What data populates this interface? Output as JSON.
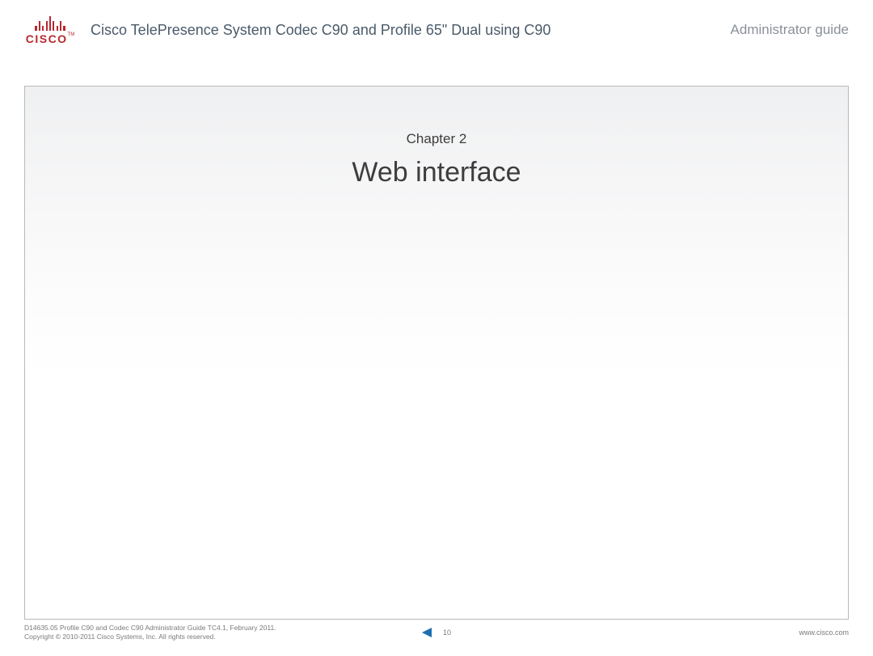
{
  "header": {
    "logo_text": "CISCO",
    "title": "Cisco TelePresence System Codec C90 and Profile 65\" Dual using C90",
    "guide": "Administrator guide"
  },
  "content": {
    "chapter_label": "Chapter 2",
    "chapter_title": "Web interface"
  },
  "footer": {
    "doc_line": "D14635.05 Profile C90 and Codec C90 Administrator Guide TC4.1, February 2011.",
    "copyright": "Copyright © 2010-2011 Cisco Systems, Inc. All rights reserved.",
    "page_number": "10",
    "url": "www.cisco.com"
  }
}
